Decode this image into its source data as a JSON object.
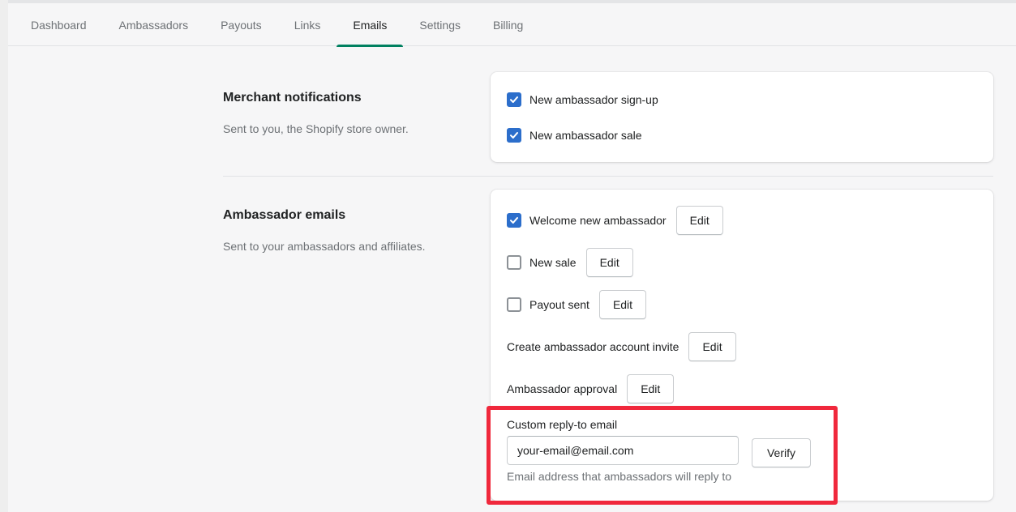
{
  "tabs": [
    {
      "label": "Dashboard",
      "active": false
    },
    {
      "label": "Ambassadors",
      "active": false
    },
    {
      "label": "Payouts",
      "active": false
    },
    {
      "label": "Links",
      "active": false
    },
    {
      "label": "Emails",
      "active": true
    },
    {
      "label": "Settings",
      "active": false
    },
    {
      "label": "Billing",
      "active": false
    }
  ],
  "merchant": {
    "title": "Merchant notifications",
    "description": "Sent to you, the Shopify store owner.",
    "items": [
      {
        "label": "New ambassador sign-up",
        "checked": true
      },
      {
        "label": "New ambassador sale",
        "checked": true
      }
    ]
  },
  "ambassador": {
    "title": "Ambassador emails",
    "description": "Sent to your ambassadors and affiliates.",
    "items": [
      {
        "label": "Welcome new ambassador",
        "checked": true,
        "edit_label": "Edit"
      },
      {
        "label": "New sale",
        "checked": false,
        "edit_label": "Edit"
      },
      {
        "label": "Payout sent",
        "checked": false,
        "edit_label": "Edit"
      },
      {
        "label": "Create ambassador account invite",
        "edit_label": "Edit"
      },
      {
        "label": "Ambassador approval",
        "edit_label": "Edit"
      }
    ],
    "reply_to": {
      "label": "Custom reply-to email",
      "value": "your-email@email.com",
      "verify_label": "Verify",
      "help": "Email address that ambassadors will reply to"
    }
  },
  "colors": {
    "accent": "#008060",
    "checkbox": "#2c6ecb",
    "highlight": "#f0283c"
  },
  "icons": {
    "checkmark": "checkmark-icon"
  }
}
